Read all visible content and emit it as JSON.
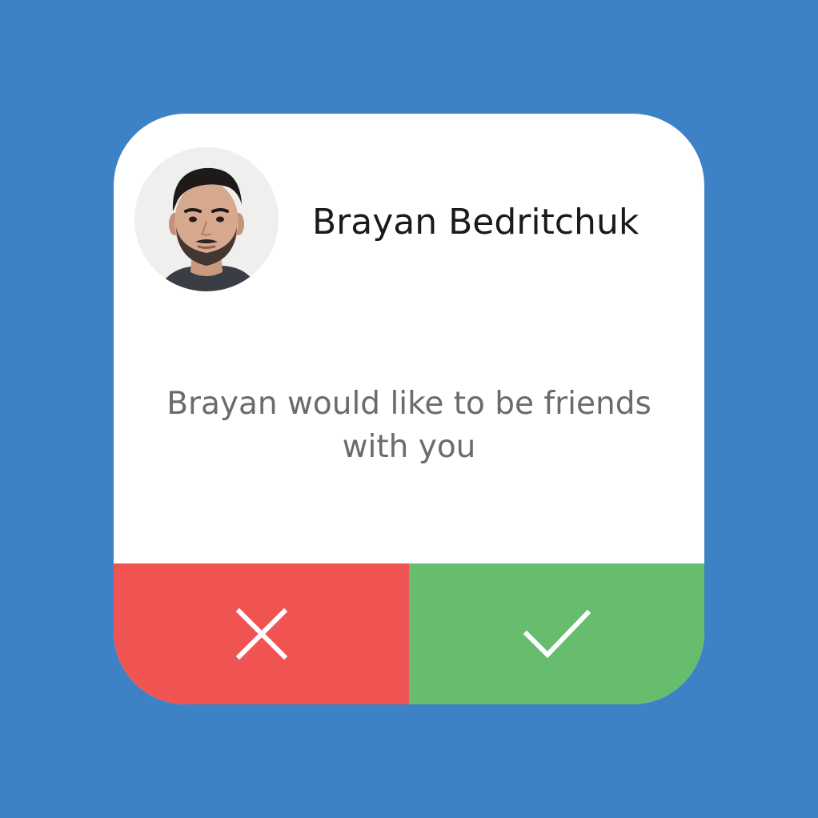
{
  "request": {
    "user_name": "Brayan Bedritchuk",
    "message": "Brayan would like to be friends with you",
    "avatar": "profile-photo"
  },
  "actions": {
    "decline_icon": "close-icon",
    "accept_icon": "checkmark-icon"
  },
  "colors": {
    "background": "#3d82c4",
    "card": "#ffffff",
    "decline": "#ef5453",
    "accept": "#66bd6d",
    "name_text": "#1a1a1a",
    "message_text": "#6b6b6b"
  }
}
